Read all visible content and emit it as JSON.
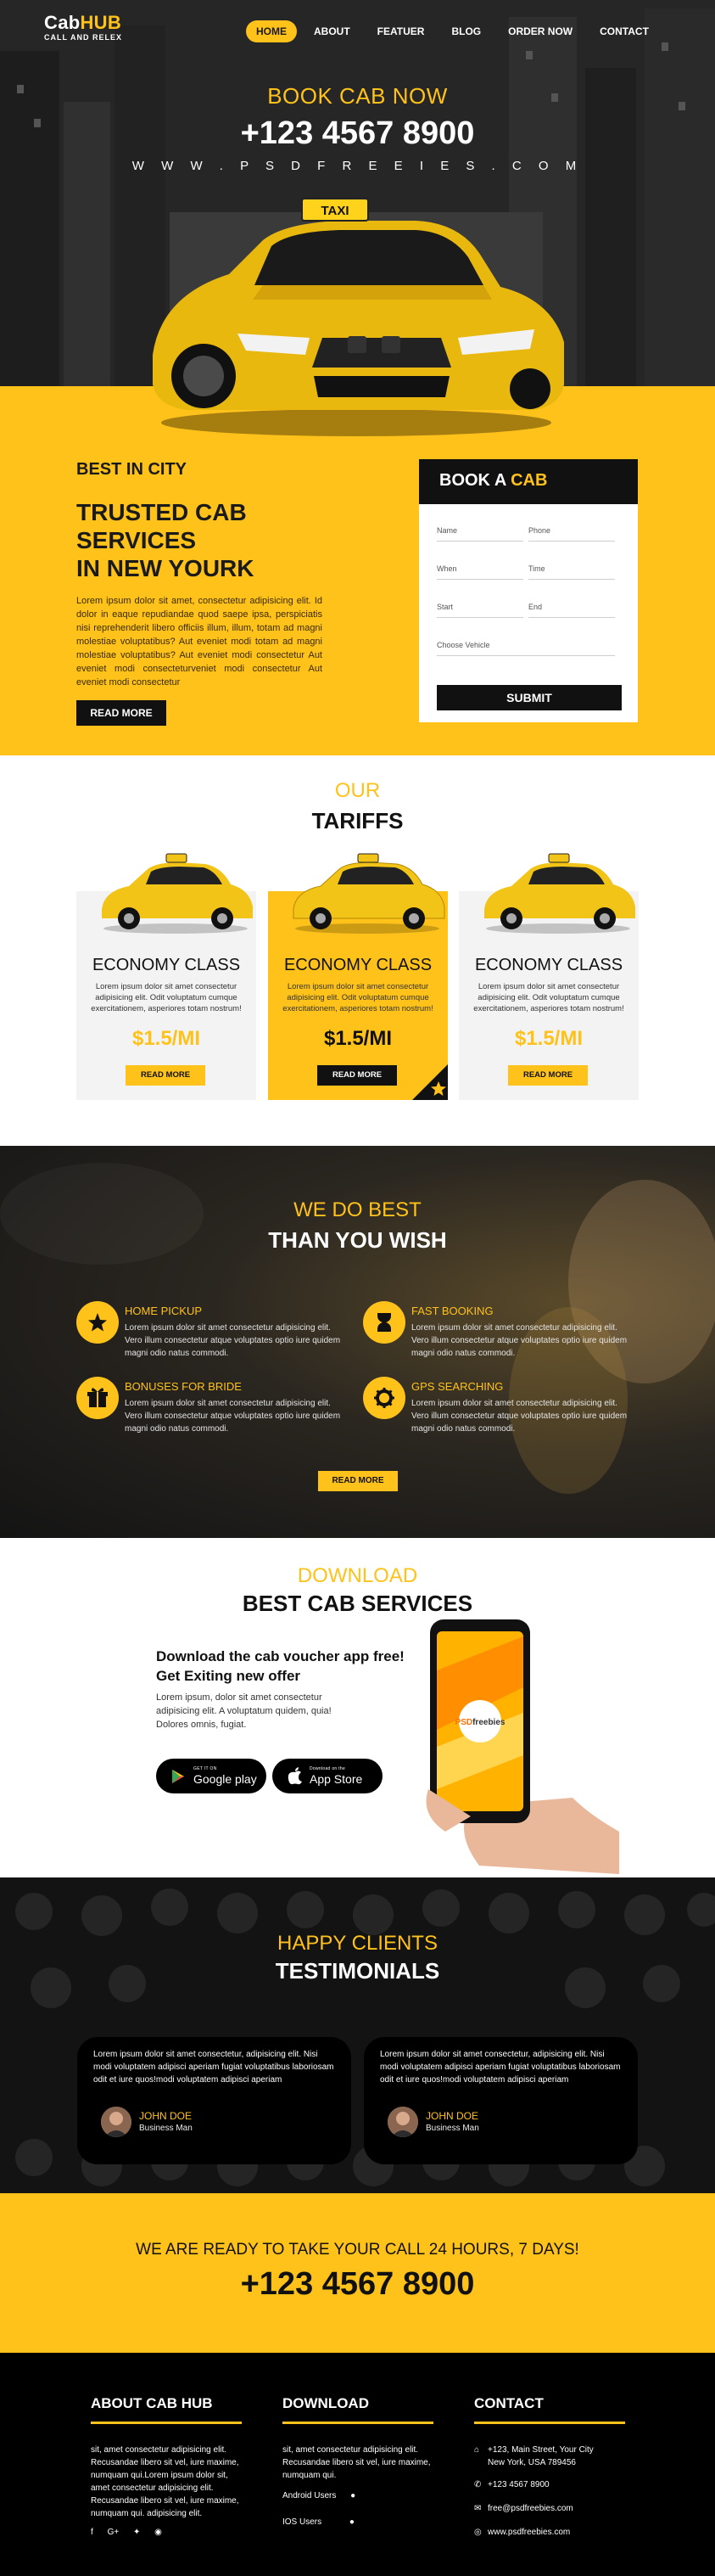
{
  "logo": {
    "brand_main": "Cab",
    "brand_accent": "HUB",
    "tagline": "CALL AND RELEX"
  },
  "nav": {
    "items": [
      "HOME",
      "ABOUT",
      "FEATUER",
      "BLOG",
      "ORDER NOW",
      "CONTACT"
    ],
    "active": "HOME"
  },
  "hero": {
    "title": "BOOK CAB NOW",
    "phone": "+123 4567 8900",
    "website": "W W W . P S D F R E E I E S . C O M",
    "taxi_sign": "TAXI"
  },
  "about": {
    "kicker": "BEST IN CITY",
    "title_line1": "TRUSTED CAB",
    "title_line2": "SERVICES",
    "title_line3": "IN NEW YOURK",
    "text": "Lorem ipsum dolor sit amet, consectetur adipisicing elit. Id dolor in eaque repudiandae quod saepe ipsa, perspiciatis nisi reprehenderit libero officiis illum, illum, totam ad magni molestiae voluptatibus? Aut eveniet modi totam ad magni molestiae voluptatibus? Aut eveniet modi consectetur Aut eveniet modi consecteturveniet modi consectetur Aut eveniet modi consectetur",
    "button": "READ MORE"
  },
  "booking": {
    "title_main": "BOOK A",
    "title_accent": "CAB",
    "fields": {
      "name": "Name",
      "phone": "Phone",
      "when": "When",
      "time": "Time",
      "start": "Start",
      "end": "End",
      "vehicle": "Choose Vehicle"
    },
    "submit": "SUBMIT"
  },
  "tariffs": {
    "kicker": "OUR",
    "title": "TARIFFS",
    "cards": [
      {
        "title": "ECONOMY CLASS",
        "text": "Lorem ipsum dolor sit amet consectetur adipisicing elit. Odit voluptatum cumque exercitationem, asperiores totam nostrum!",
        "price": "$1.5/MI",
        "button": "READ MORE"
      },
      {
        "title": "ECONOMY CLASS",
        "text": "Lorem ipsum dolor sit amet consectetur adipisicing elit. Odit voluptatum cumque exercitationem, asperiores totam nostrum!",
        "price": "$1.5/MI",
        "button": "READ MORE"
      },
      {
        "title": "ECONOMY CLASS",
        "text": "Lorem ipsum dolor sit amet consectetur adipisicing elit. Odit voluptatum cumque exercitationem, asperiores totam nostrum!",
        "price": "$1.5/MI",
        "button": "READ MORE"
      }
    ]
  },
  "best": {
    "kicker": "WE DO BEST",
    "title": "THAN YOU WISH",
    "features": [
      {
        "title": "HOME PICKUP",
        "icon": "star-icon",
        "text": "Lorem ipsum dolor sit amet consectetur adipisicing elit. Vero illum consectetur atque voluptates optio iure quidem magni odio natus commodi."
      },
      {
        "title": "FAST BOOKING",
        "icon": "hourglass-icon",
        "text": "Lorem ipsum dolor sit amet consectetur adipisicing elit. Vero illum consectetur atque voluptates optio iure quidem magni odio natus commodi."
      },
      {
        "title": "BONUSES FOR BRIDE",
        "icon": "gift-icon",
        "text": "Lorem ipsum dolor sit amet consectetur adipisicing elit. Vero illum consectetur atque voluptates optio iure quidem magni odio natus commodi."
      },
      {
        "title": "GPS SEARCHING",
        "icon": "gear-icon",
        "text": "Lorem ipsum dolor sit amet consectetur adipisicing elit. Vero illum consectetur atque voluptates optio iure quidem magni odio natus commodi."
      }
    ],
    "button": "READ MORE"
  },
  "download": {
    "kicker": "DOWNLOAD",
    "title": "BEST CAB SERVICES",
    "headline_line1": "Download the cab voucher app free!",
    "headline_line2": "Get Exiting new offer",
    "text": "Lorem ipsum, dolor sit amet consectetur adipisicing elit. A voluptatum quidem, quia! Dolores omnis, fugiat.",
    "google_small": "GET IT ON",
    "google_big": "Google play",
    "apple_small": "Download on the",
    "apple_big": "App Store",
    "phone_brand_accent": "PSD",
    "phone_brand": "freebies"
  },
  "testimonials": {
    "kicker": "HAPPY CLIENTS",
    "title": "TESTIMONIALS",
    "items": [
      {
        "text": "Lorem ipsum dolor sit amet consectetur, adipisicing elit. Nisi modi voluptatem adipisci aperiam fugiat voluptatibus laboriosam odit et iure quos!modi voluptatem adipisci aperiam",
        "name": "JOHN DOE",
        "role": "Business Man"
      },
      {
        "text": "Lorem ipsum dolor sit amet consectetur, adipisicing elit. Nisi modi voluptatem adipisci aperiam fugiat voluptatibus laboriosam odit et iure quos!modi voluptatem adipisci aperiam",
        "name": "JOHN DOE",
        "role": "Business Man"
      }
    ]
  },
  "call": {
    "line": "WE ARE READY TO TAKE YOUR CALL 24 HOURS, 7 DAYS!",
    "phone": "+123 4567 8900"
  },
  "footer": {
    "about_title": "ABOUT CAB HUB",
    "about_text": "sit, amet consectetur adipisicing elit. Recusandae libero sit vel, iure maxime, numquam qui.Lorem ipsum dolor sit, amet consectetur adipisicing elit. Recusandae libero sit vel, iure maxime, numquam qui. adipisicing elit.",
    "download_title": "DOWNLOAD",
    "download_text": "sit, amet consectetur adipisicing elit. Recusandae libero sit vel, iure maxime, numquam qui.",
    "android_label": "Android Users",
    "ios_label": "IOS Users",
    "contact_title": "CONTACT",
    "address_line1": "+123, Main Street, Your City",
    "address_line2": "New York, USA 789456",
    "phone": "+123 4567 8900",
    "email": "free@psdfreebies.com",
    "website": "www.psdfreebies.com",
    "social_icons": [
      "facebook-icon",
      "google-plus-icon",
      "twitter-icon",
      "instagram-icon"
    ]
  },
  "colors": {
    "accent": "#ffc21a",
    "dark": "#111111",
    "light_card": "#f3f3f3"
  }
}
